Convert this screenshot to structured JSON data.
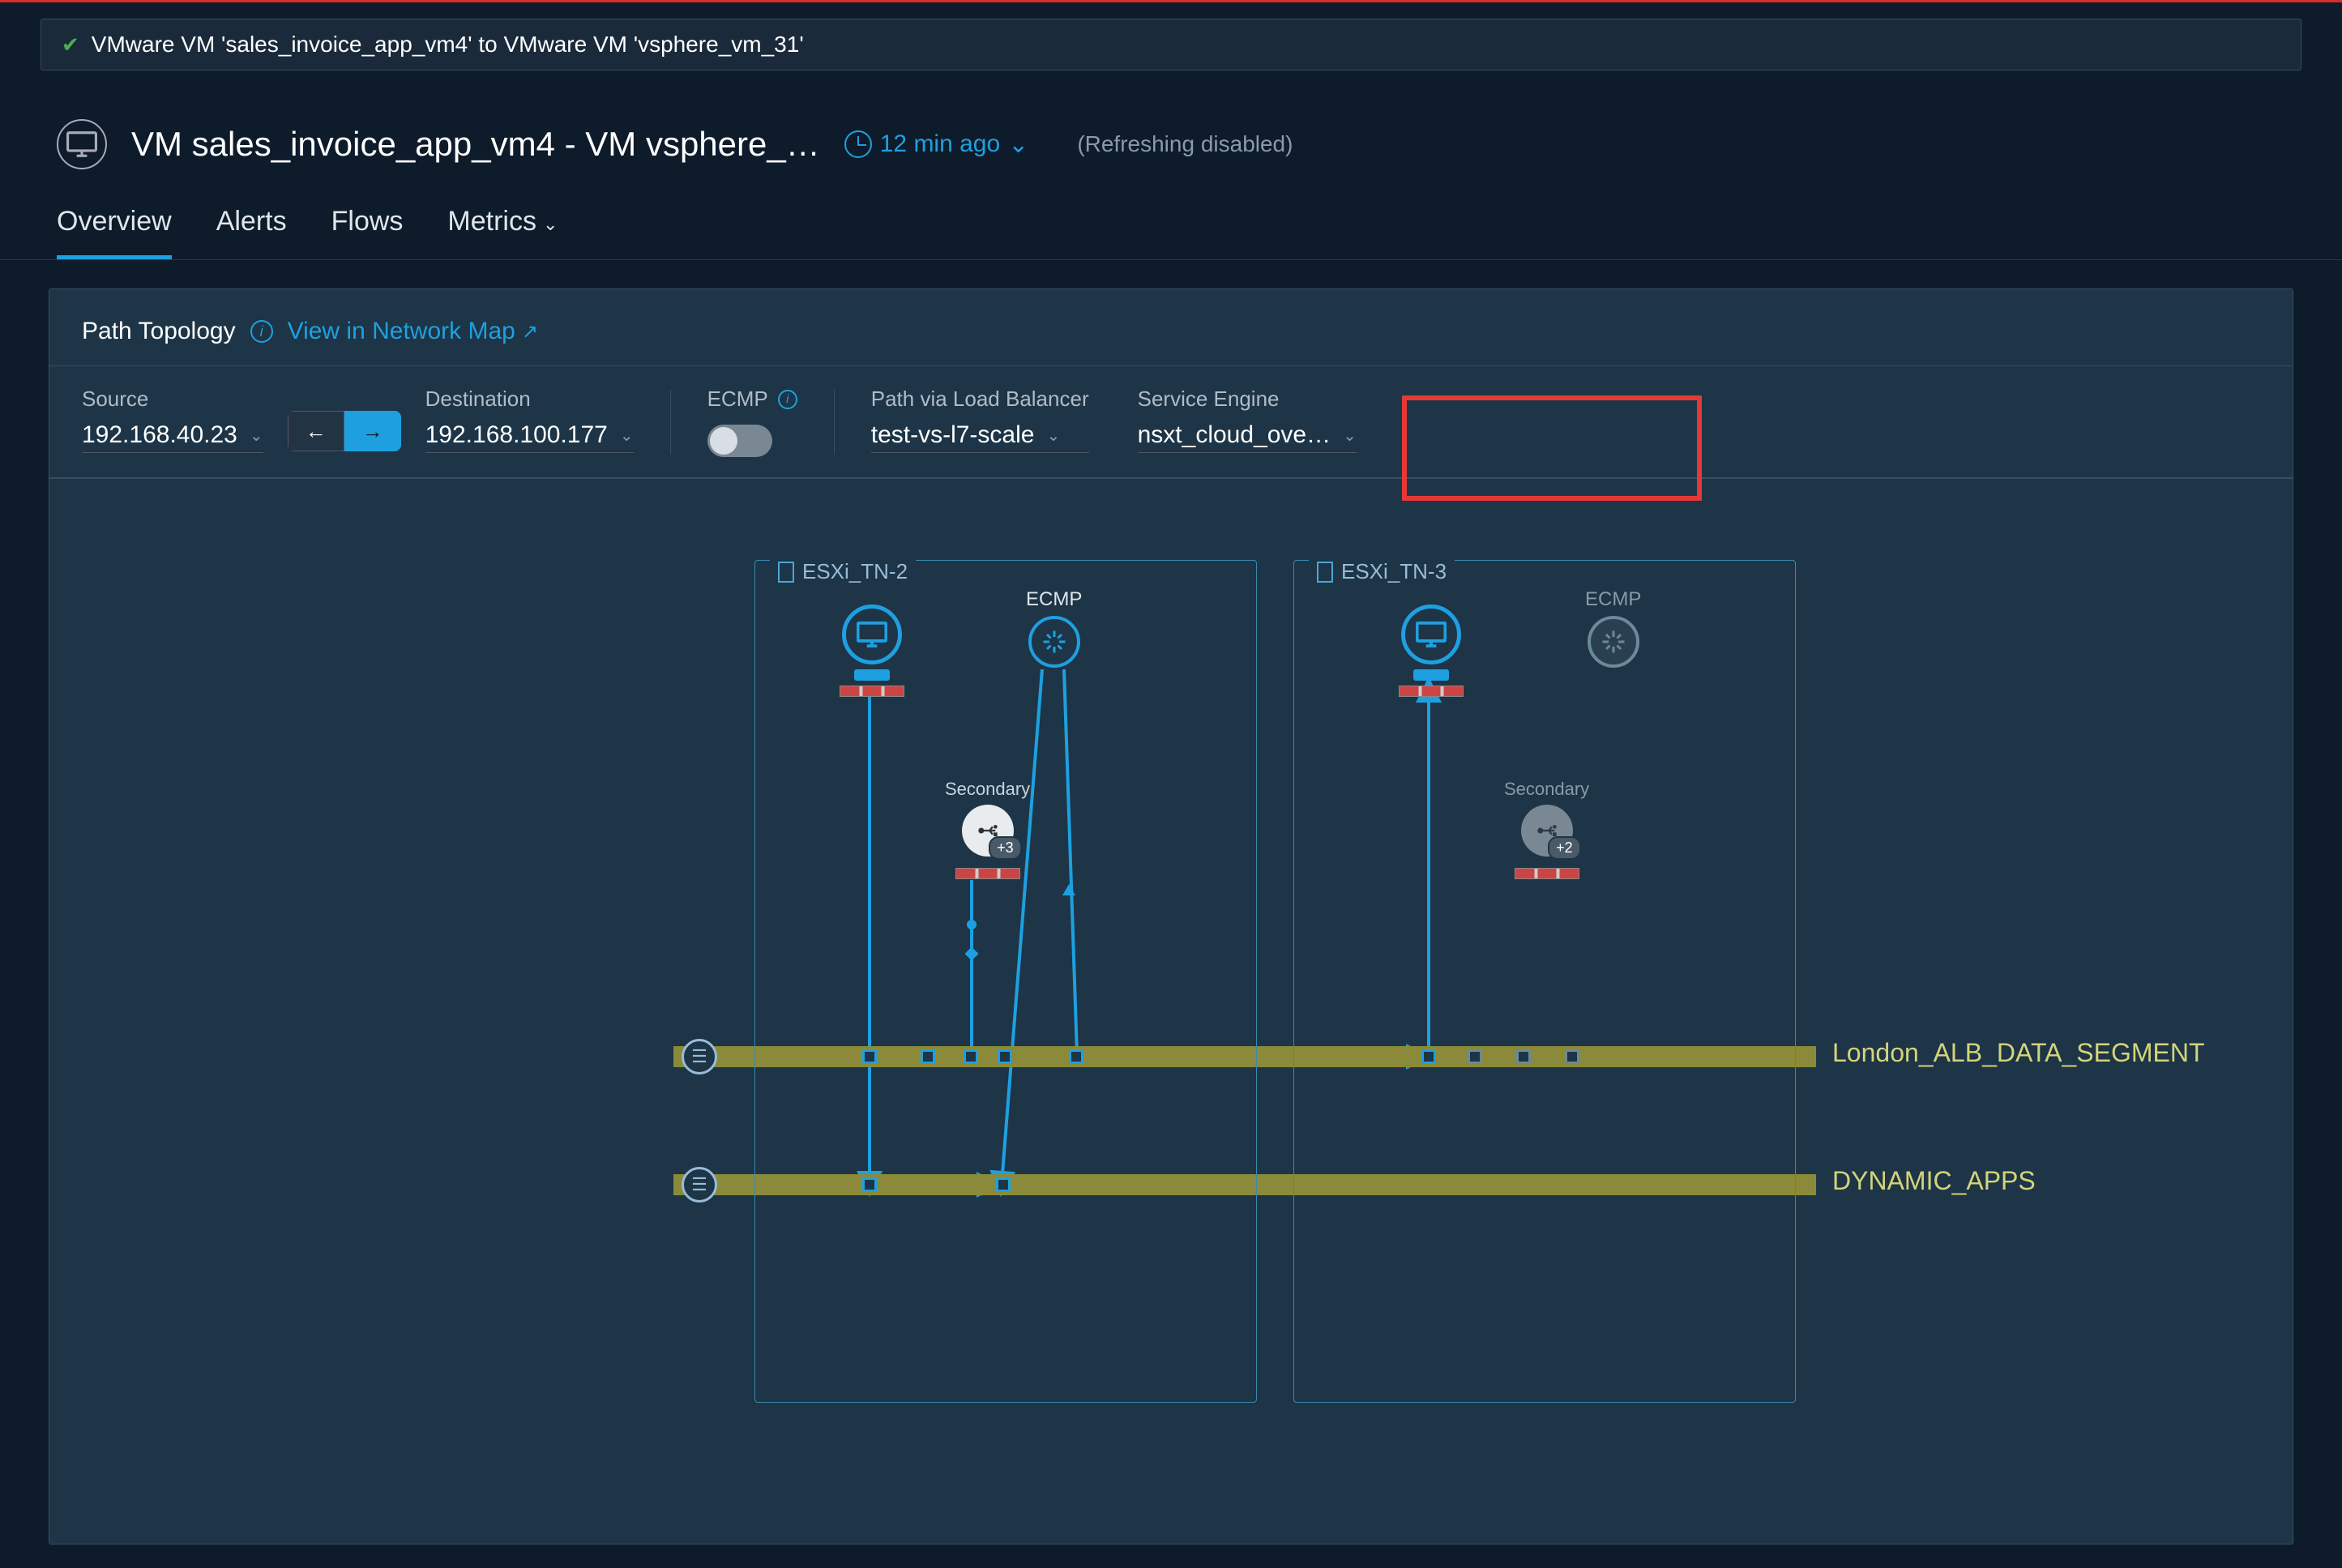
{
  "search": {
    "text": "VMware VM 'sales_invoice_app_vm4' to VMware VM 'vsphere_vm_31'"
  },
  "header": {
    "title": "VM sales_invoice_app_vm4 - VM vsphere_…",
    "time_badge": "12 min ago",
    "refreshing": "(Refreshing  disabled)"
  },
  "tabs": {
    "overview": "Overview",
    "alerts": "Alerts",
    "flows": "Flows",
    "metrics": "Metrics"
  },
  "panel": {
    "title": "Path Topology",
    "map_link": "View in Network Map"
  },
  "filters": {
    "source_label": "Source",
    "source_value": "192.168.40.23",
    "dest_label": "Destination",
    "dest_value": "192.168.100.177",
    "ecmp_label": "ECMP",
    "lb_label": "Path via Load Balancer",
    "lb_value": "test-vs-l7-scale",
    "se_label": "Service Engine",
    "se_value": "nsxt_cloud_ove…"
  },
  "topology": {
    "host1": "ESXi_TN-2",
    "host2": "ESXi_TN-3",
    "ecmp_label": "ECMP",
    "secondary_label": "Secondary",
    "sec_badge1": "+3",
    "sec_badge2": "+2",
    "segment1": "London_ALB_DATA_SEGMENT",
    "segment2": "DYNAMIC_APPS"
  }
}
